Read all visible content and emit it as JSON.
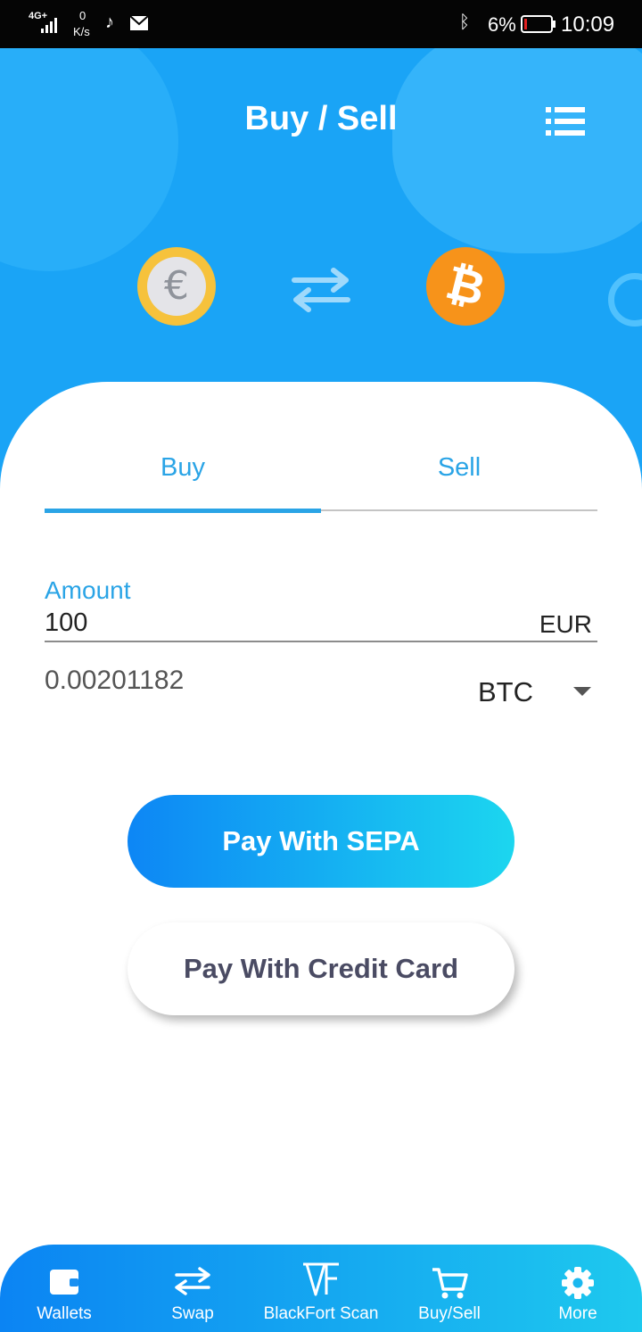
{
  "status_bar": {
    "network": "4G+",
    "speed_value": "0",
    "speed_unit": "K/s",
    "battery_percent": "6%",
    "time": "10:09"
  },
  "header": {
    "title": "Buy / Sell",
    "menu_icon": "list-menu-icon"
  },
  "exchange_visual": {
    "from_symbol": "€",
    "from_icon": "euro-coin-icon",
    "swap_icon": "swap-arrows-icon",
    "to_symbol": "₿",
    "to_icon": "bitcoin-coin-icon"
  },
  "tabs": [
    {
      "label": "Buy",
      "active": true
    },
    {
      "label": "Sell",
      "active": false
    }
  ],
  "form": {
    "amount_label": "Amount",
    "amount_value": "100",
    "amount_currency": "EUR",
    "converted_value": "0.00201182",
    "crypto_selected": "BTC"
  },
  "buttons": {
    "sepa": "Pay With SEPA",
    "credit_card": "Pay With Credit Card"
  },
  "bottom_nav": [
    {
      "label": "Wallets",
      "icon": "wallet-icon"
    },
    {
      "label": "Swap",
      "icon": "swap-icon"
    },
    {
      "label": "BlackFort Scan",
      "icon": "blackfort-logo-icon"
    },
    {
      "label": "Buy/Sell",
      "icon": "cart-icon"
    },
    {
      "label": "More",
      "icon": "gear-icon"
    }
  ],
  "colors": {
    "primary": "#1aa4f6",
    "accent_text": "#2aa4e6",
    "btc_orange": "#f7931a",
    "euro_gold": "#f6c23c"
  }
}
